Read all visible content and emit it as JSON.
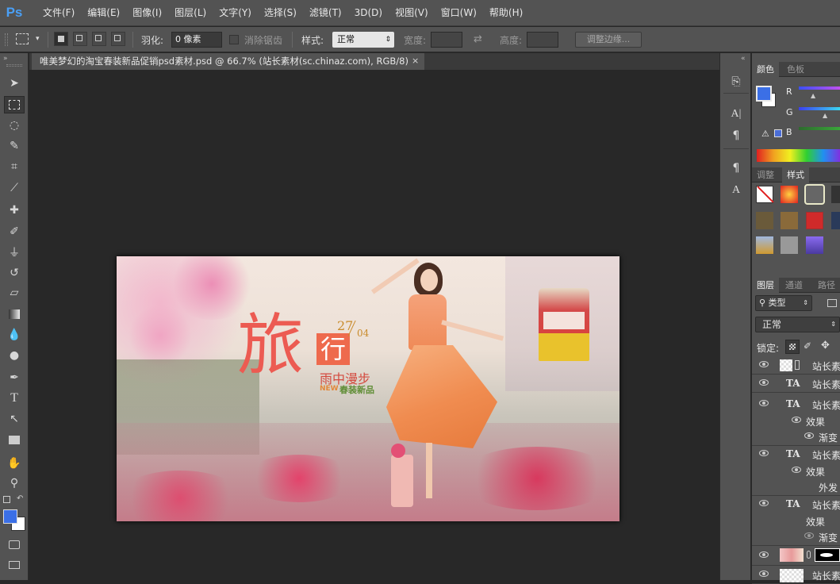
{
  "app": {
    "logo": "Ps"
  },
  "menu": [
    "文件(F)",
    "编辑(E)",
    "图像(I)",
    "图层(L)",
    "文字(Y)",
    "选择(S)",
    "滤镜(T)",
    "3D(D)",
    "视图(V)",
    "窗口(W)",
    "帮助(H)"
  ],
  "options": {
    "feather_label": "羽化:",
    "feather_value": "0 像素",
    "antialias_label": "消除锯齿",
    "style_label": "样式:",
    "style_value": "正常",
    "width_label": "宽度:",
    "height_label": "高度:",
    "refine_edge": "调整边缘..."
  },
  "document": {
    "tab_title": "唯美梦幻的淘宝春装新品促销psd素材.psd @ 66.7% (站长素材(sc.chinaz.com), RGB/8)",
    "close": "×"
  },
  "banner": {
    "title_big": "旅",
    "title_small": "行",
    "date_day": "27",
    "date_month": "04",
    "subtitle": "雨中漫步",
    "new_label": "NEW",
    "tagline": "春装新品"
  },
  "panels": {
    "color_tabs": [
      "颜色",
      "色板"
    ],
    "color_channels": [
      "R",
      "G",
      "B"
    ],
    "style_tabs": [
      "调整",
      "样式"
    ],
    "layer_tabs": [
      "图层",
      "通道",
      "路径"
    ],
    "layer_filter": "类型",
    "blend_mode": "正常",
    "lock_label": "锁定:",
    "layers": [
      {
        "name": "站长素",
        "kind": "image"
      },
      {
        "name": "站长素",
        "kind": "text"
      },
      {
        "name": "站长素",
        "kind": "text"
      },
      {
        "name": "效果",
        "kind": "effect"
      },
      {
        "name": "渐变",
        "kind": "effect-item"
      },
      {
        "name": "站长素",
        "kind": "text"
      },
      {
        "name": "效果",
        "kind": "effect"
      },
      {
        "name": "外发",
        "kind": "effect-item"
      },
      {
        "name": "站长素",
        "kind": "text"
      },
      {
        "name": "效果",
        "kind": "effect"
      },
      {
        "name": "渐变",
        "kind": "effect-item"
      },
      {
        "name": "",
        "kind": "image-mask"
      },
      {
        "name": "站长素",
        "kind": "image"
      }
    ]
  },
  "colors": {
    "foreground": "#3b6fe6",
    "background": "#ffffff",
    "accent_ps": "#4a9ff5"
  }
}
